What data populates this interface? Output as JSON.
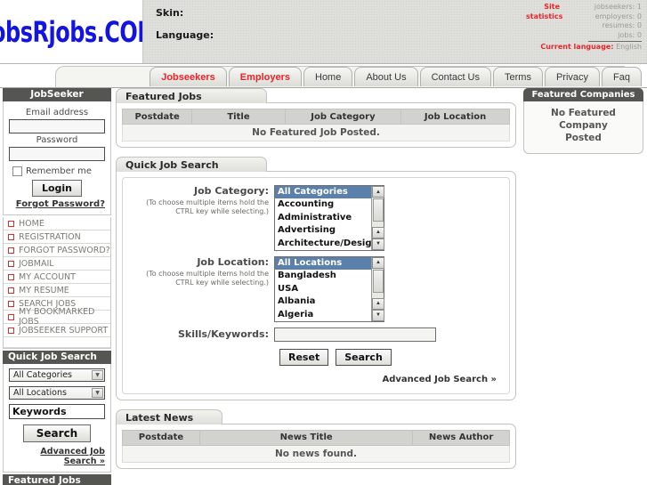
{
  "header": {
    "logo": "jobsRjobs.COM",
    "skin_label": "Skin:",
    "language_label": "Language:",
    "stats_title_line1": "Site",
    "stats_title_line2": "statistics",
    "stats": [
      {
        "label": "jobseekers:",
        "value": "1"
      },
      {
        "label": "employers:",
        "value": "0"
      },
      {
        "label": "resumes:",
        "value": "0"
      },
      {
        "label": "jobs:",
        "value": "0"
      }
    ],
    "current_language_label": "Current language:",
    "current_language_value": "English",
    "accent_color": "#e8252a"
  },
  "nav": {
    "tabs": [
      {
        "label": "Jobseekers",
        "accent": true
      },
      {
        "label": "Employers",
        "accent": true
      },
      {
        "label": "Home",
        "accent": false
      },
      {
        "label": "About Us",
        "accent": false
      },
      {
        "label": "Contact Us",
        "accent": false
      },
      {
        "label": "Terms",
        "accent": false
      },
      {
        "label": "Privacy",
        "accent": false
      },
      {
        "label": "Faq",
        "accent": false
      }
    ]
  },
  "sidebar": {
    "login_panel": {
      "title": "JobSeeker",
      "email_label": "Email address",
      "email_value": "",
      "email_placeholder": "",
      "password_label": "Password",
      "password_value": "",
      "remember_label": "Remember me",
      "login_button": "Login",
      "forgot_link": "Forgot Password?"
    },
    "menu": [
      {
        "label": "HOME"
      },
      {
        "label": "REGISTRATION"
      },
      {
        "label": "FORGOT PASSWORD?"
      },
      {
        "label": "JOBMAIL"
      },
      {
        "label": "MY ACCOUNT"
      },
      {
        "label": "MY RESUME"
      },
      {
        "label": "SEARCH JOBS"
      },
      {
        "label": "MY BOOKMARKED JOBS"
      },
      {
        "label": "JOBSEEKER SUPPORT"
      }
    ],
    "quick_search": {
      "title": "Quick Job Search",
      "category_value": "All Categories",
      "location_value": "All Locations",
      "keywords_value": "Keywords",
      "search_button": "Search",
      "advanced_link": "Advanced Job Search »"
    },
    "featured_jobs_title": "Featured Jobs"
  },
  "main": {
    "featured_jobs": {
      "title": "Featured Jobs",
      "columns": [
        "Postdate",
        "Title",
        "Job Category",
        "Job Location"
      ],
      "empty_message": "No Featured Job Posted."
    },
    "quick_job_search": {
      "title": "Quick Job Search",
      "category_label": "Job Category:",
      "category_hint": "(To choose multiple items hold the CTRL key while selecting.)",
      "category_options": [
        "All Categories",
        "Accounting",
        "Administrative",
        "Advertising",
        "Architecture/Design"
      ],
      "category_selected": "All Categories",
      "location_label": "Job Location:",
      "location_hint": "(To choose multiple items hold the CTRL key while selecting.)",
      "location_options": [
        "All Locations",
        "Bangladesh",
        "USA",
        "Albania",
        "Algeria"
      ],
      "location_selected": "All Locations",
      "skills_label": "Skills/Keywords:",
      "skills_value": "",
      "reset_button": "Reset",
      "search_button": "Search",
      "advanced_link": "Advanced Job Search »"
    },
    "latest_news": {
      "title": "Latest News",
      "columns": [
        "Postdate",
        "News Title",
        "News Author"
      ],
      "empty_message": "No news found."
    }
  },
  "right": {
    "featured_companies": {
      "title": "Featured Companies",
      "empty_line1": "No Featured Company",
      "empty_line2": "Posted"
    }
  }
}
